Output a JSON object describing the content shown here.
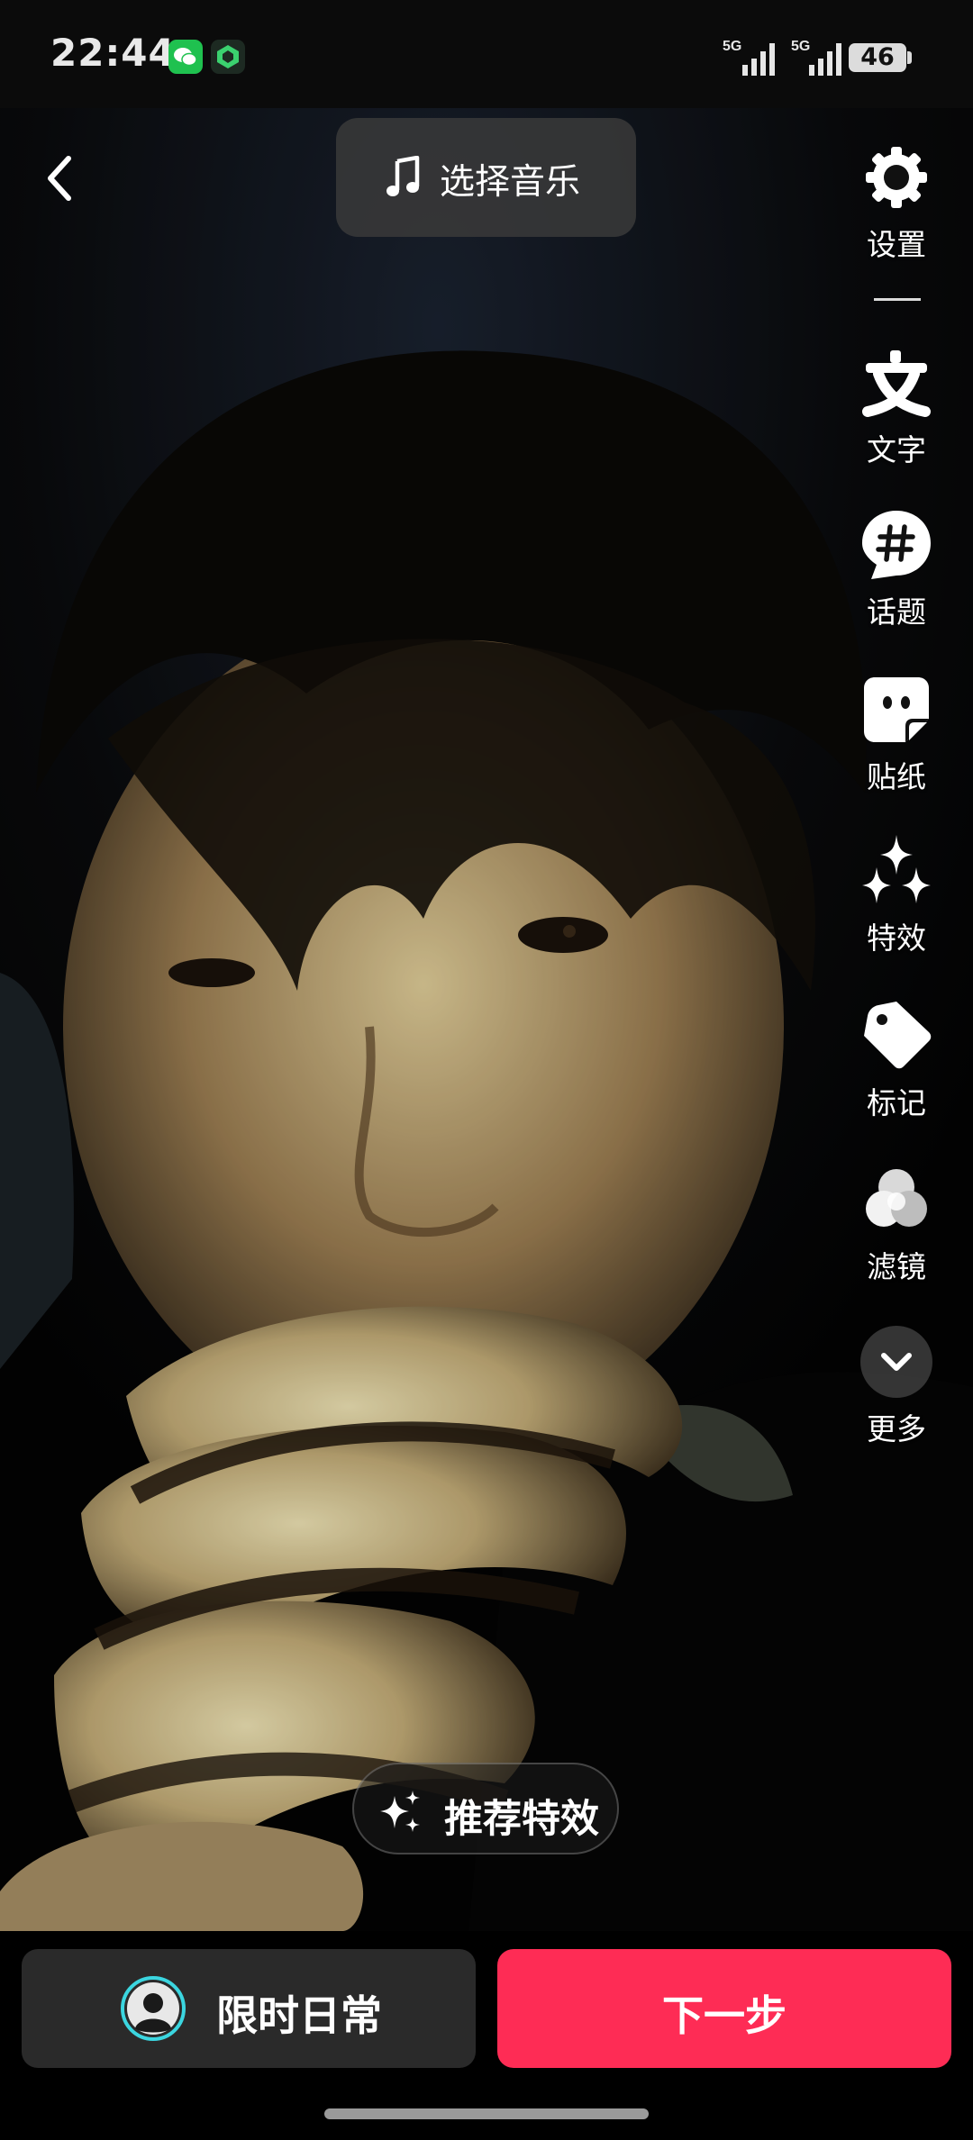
{
  "status_bar": {
    "time": "22:44",
    "signal_1_label": "5G",
    "signal_2_label": "5G",
    "battery": "46",
    "app_icons": [
      "wechat-icon",
      "shield-app-icon"
    ]
  },
  "top_bar": {
    "back_icon": "chevron-left-icon",
    "music_button_label": "选择音乐",
    "music_icon": "music-note-icon"
  },
  "toolbar": {
    "items": [
      {
        "label": "设置",
        "icon": "gear-icon"
      },
      {
        "label": "文字",
        "icon": "text-icon"
      },
      {
        "label": "话题",
        "icon": "hashtag-icon"
      },
      {
        "label": "贴纸",
        "icon": "sticker-icon"
      },
      {
        "label": "特效",
        "icon": "sparkles-icon"
      },
      {
        "label": "标记",
        "icon": "tag-icon"
      },
      {
        "label": "滤镜",
        "icon": "filter-icon"
      },
      {
        "label": "更多",
        "icon": "chevron-down-icon"
      }
    ]
  },
  "recommend": {
    "label": "推荐特效",
    "icon": "sparkles-icon"
  },
  "bottom_bar": {
    "daily_label": "限时日常",
    "next_label": "下一步",
    "colors": {
      "next_button": "#fe2c55",
      "daily_button": "#2a2a2a"
    }
  }
}
